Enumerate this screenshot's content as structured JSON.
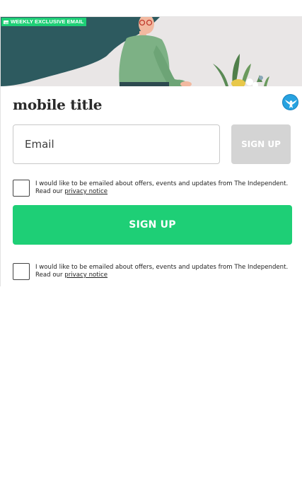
{
  "hero": {
    "badge_label": "WEEKLY EXCLUSIVE EMAIL",
    "badge_icon": "mail-icon"
  },
  "form": {
    "title": "mobile title",
    "logo_icon": "independent-eagle-logo",
    "email_placeholder": "Email",
    "email_value": "",
    "signup_small_label": "SIGN UP",
    "consent_text": "I would like to be emailed about offers, events and updates from The Independent. Read our",
    "privacy_link": "privacy notice",
    "signup_big_label": "SIGN UP",
    "consent_text_2": "I would like to be emailed about offers, events and updates from The Independent. Read our",
    "privacy_link_2": "privacy notice"
  },
  "colors": {
    "accent_green": "#1ecf76",
    "disabled_grey": "#d4d4d4",
    "hero_teal": "#2d5a5f",
    "logo_blue": "#27a2e0"
  }
}
